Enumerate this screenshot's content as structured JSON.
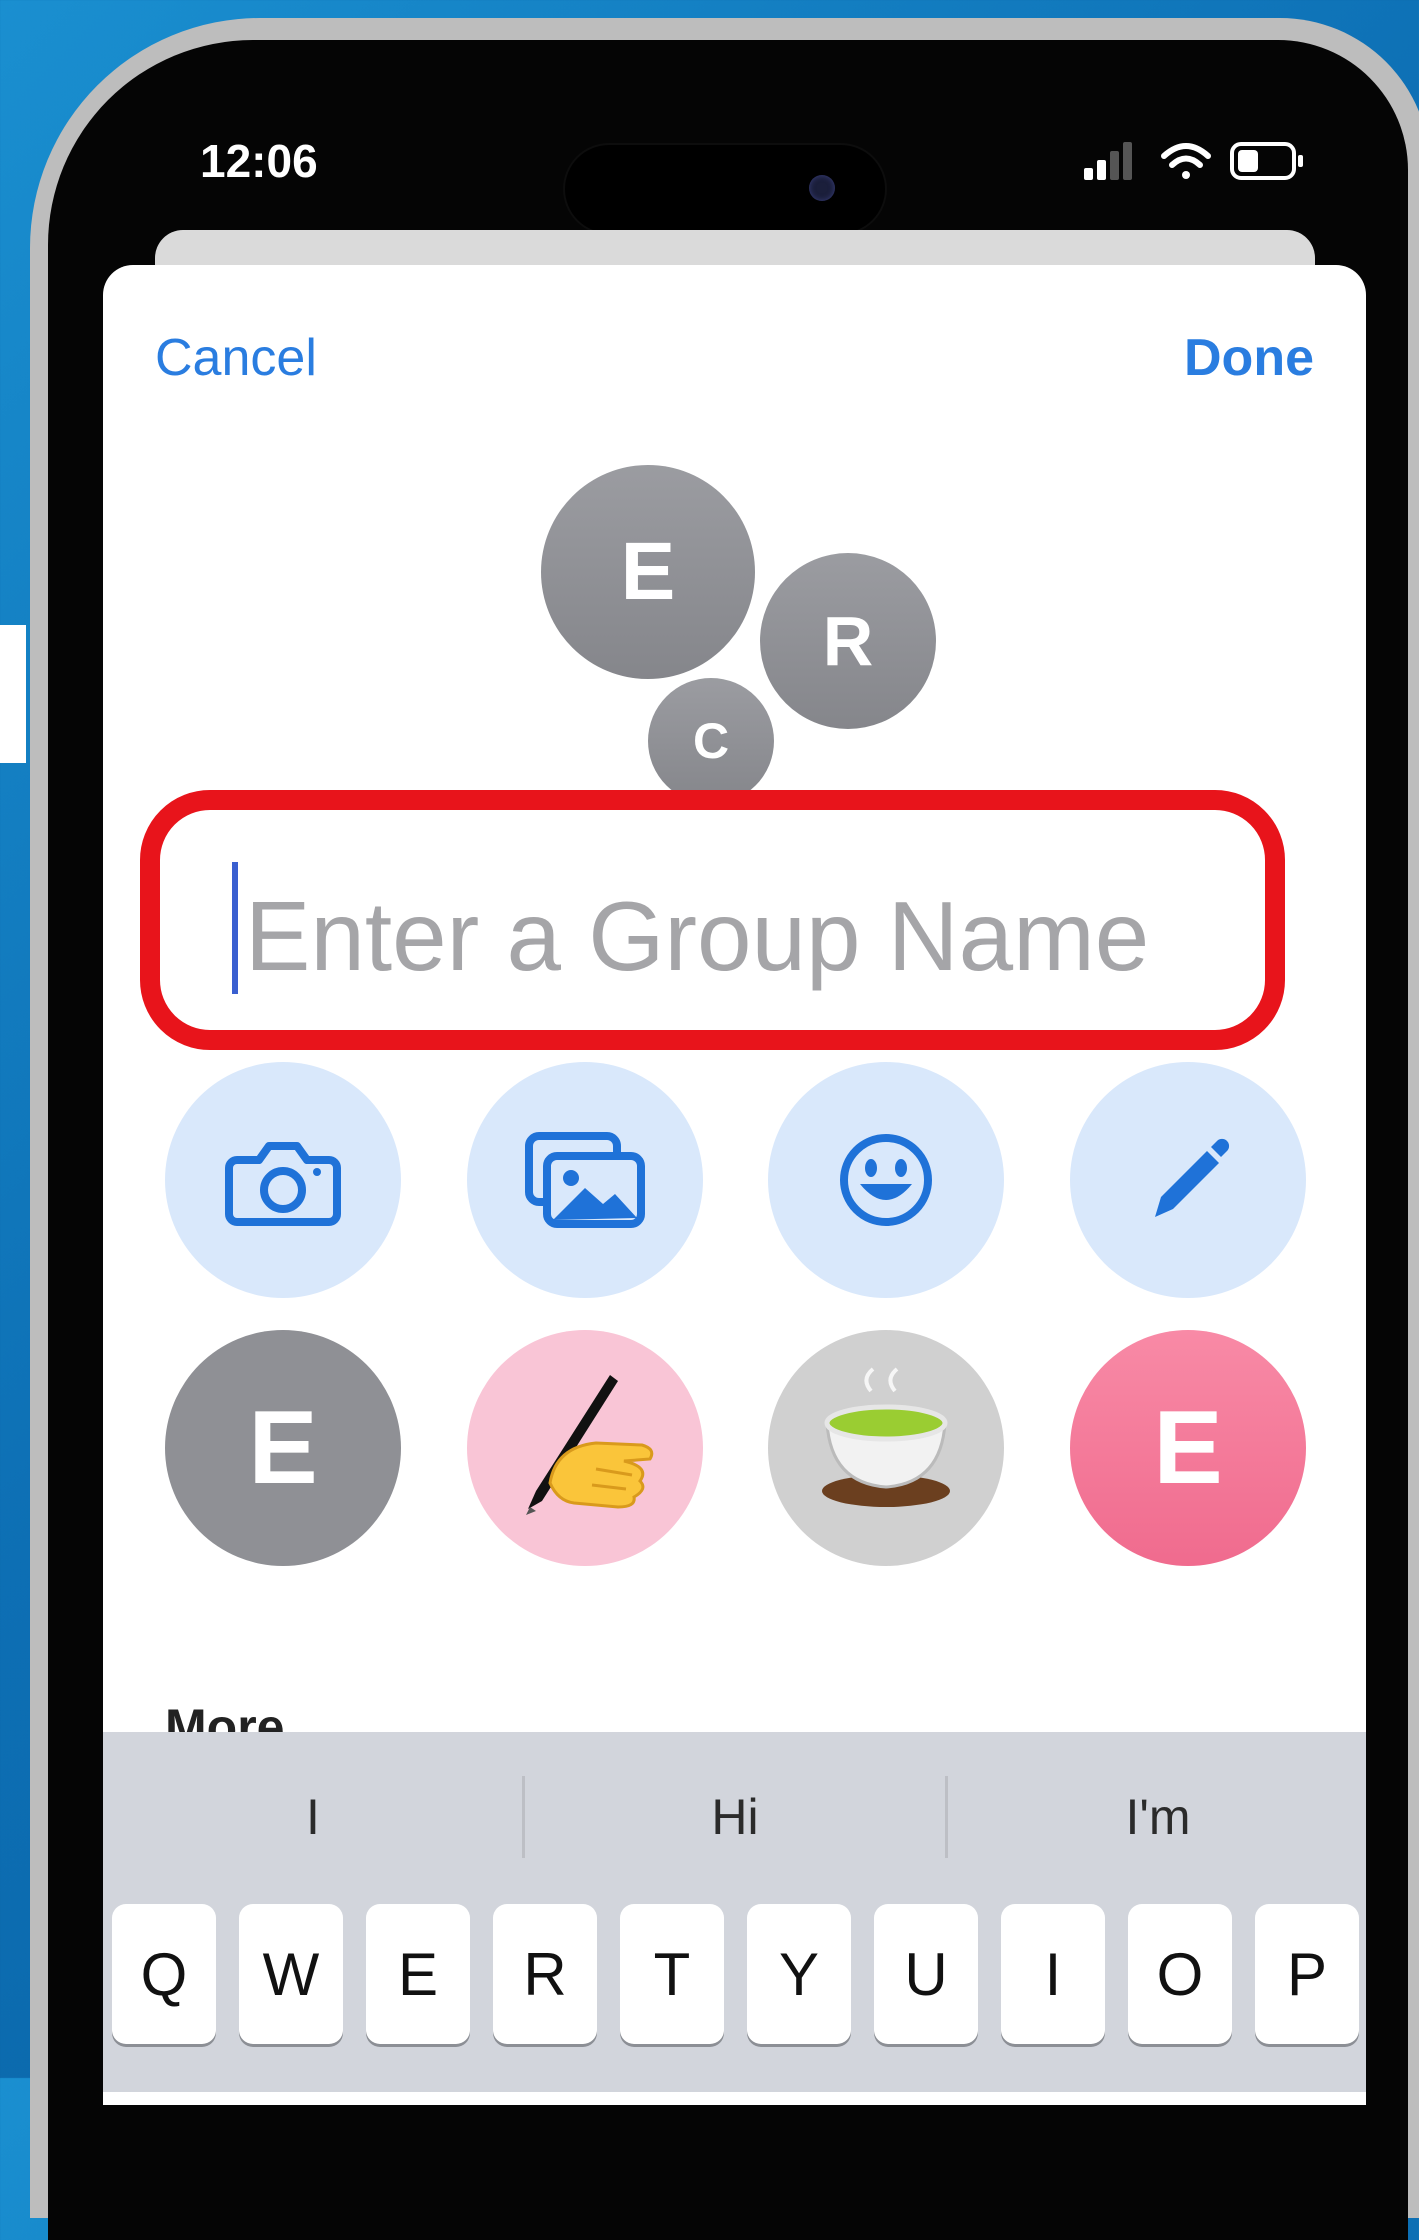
{
  "status_bar": {
    "time": "12:06"
  },
  "nav": {
    "cancel_label": "Cancel",
    "done_label": "Done"
  },
  "group_avatars": [
    {
      "letter": "E"
    },
    {
      "letter": "R"
    },
    {
      "letter": "C"
    }
  ],
  "name_field": {
    "placeholder": "Enter a Group Name",
    "highlight_color": "#e8141b"
  },
  "photo_options": [
    {
      "icon": "camera-icon"
    },
    {
      "icon": "photos-icon"
    },
    {
      "icon": "emoji-icon"
    },
    {
      "icon": "pencil-icon"
    }
  ],
  "avatar_options": [
    {
      "label": "E",
      "kind": "monogram",
      "color": "#8f9095"
    },
    {
      "icon": "writing-hand-emoji",
      "kind": "emoji",
      "color": "#f9c5d6"
    },
    {
      "icon": "green-tea-emoji",
      "kind": "emoji",
      "color": "#d0d0d0"
    },
    {
      "label": "E",
      "kind": "monogram",
      "color": "#f27998"
    }
  ],
  "section": {
    "more_label": "More"
  },
  "keyboard": {
    "suggestions": [
      "I",
      "Hi",
      "I'm"
    ],
    "row1": [
      "Q",
      "W",
      "E",
      "R",
      "T",
      "Y",
      "U",
      "I",
      "O",
      "P"
    ]
  },
  "colors": {
    "accent": "#2a7de0",
    "background": "#0d6fb4"
  }
}
